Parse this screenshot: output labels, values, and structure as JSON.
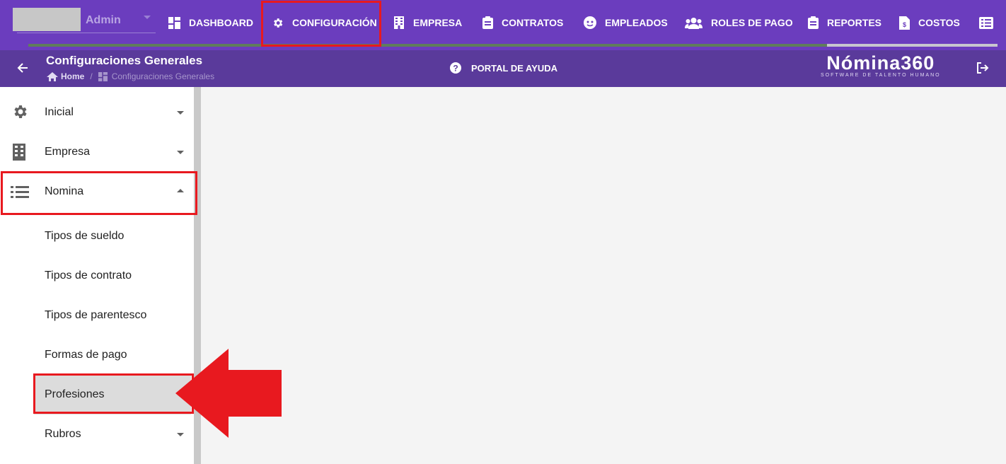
{
  "user": {
    "name": "Admin"
  },
  "topnav": {
    "items": [
      {
        "label": "DASHBOARD",
        "icon": "dashboard-icon"
      },
      {
        "label": "CONFIGURACIÓN",
        "icon": "gear-icon"
      },
      {
        "label": "EMPRESA",
        "icon": "building-icon"
      },
      {
        "label": "CONTRATOS",
        "icon": "clipboard-icon"
      },
      {
        "label": "EMPLEADOS",
        "icon": "face-icon"
      },
      {
        "label": "ROLES DE PAGO",
        "icon": "people-icon"
      },
      {
        "label": "REPORTES",
        "icon": "clipboard-icon"
      },
      {
        "label": "COSTOS",
        "icon": "invoice-icon"
      }
    ],
    "more_icon": "list-icon",
    "highlight_color": "#e8191f",
    "bg_color": "#6b3dbe"
  },
  "header": {
    "title": "Configuraciones Generales",
    "breadcrumb": {
      "home": "Home",
      "separator": "/",
      "current": "Configuraciones Generales"
    },
    "help_label": "PORTAL DE AYUDA",
    "brand_name": "Nómina360",
    "brand_tagline": "SOFTWARE DE TALENTO HUMANO",
    "bg_color": "#5a3a9b"
  },
  "sidebar": {
    "sections": [
      {
        "label": "Inicial",
        "icon": "gear-icon",
        "expanded": false
      },
      {
        "label": "Empresa",
        "icon": "building-icon",
        "expanded": false
      },
      {
        "label": "Nomina",
        "icon": "list-icon",
        "expanded": true
      }
    ],
    "nomina_items": [
      {
        "label": "Tipos de sueldo"
      },
      {
        "label": "Tipos de contrato"
      },
      {
        "label": "Tipos de parentesco"
      },
      {
        "label": "Formas de pago"
      },
      {
        "label": "Profesiones",
        "active": true
      },
      {
        "label": "Rubros",
        "has_children": true
      }
    ]
  }
}
